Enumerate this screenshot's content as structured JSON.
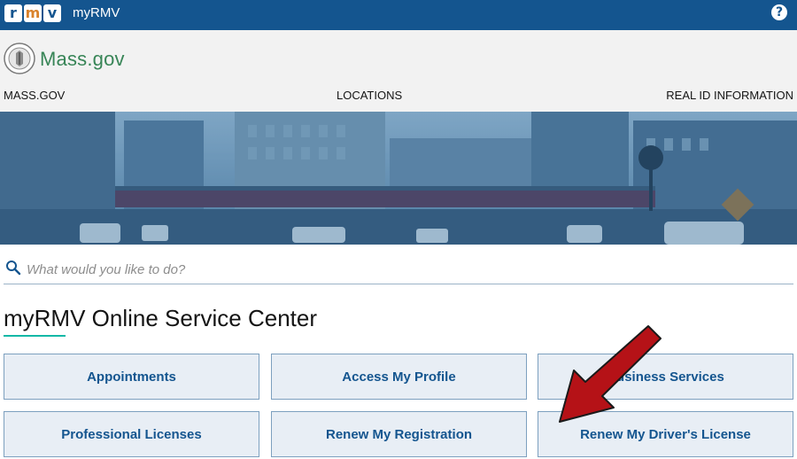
{
  "topbar": {
    "logo_letters": [
      "r",
      "m",
      "v"
    ],
    "app_title": "myRMV",
    "help_symbol": "?"
  },
  "mass_header": {
    "site_name": "Mass.gov",
    "nav": [
      "MASS.GOV",
      "LOCATIONS",
      "REAL ID INFORMATION"
    ]
  },
  "search": {
    "placeholder": "What would you like to do?"
  },
  "main": {
    "title": "myRMV Online Service Center",
    "services": [
      "Appointments",
      "Access My Profile",
      "Business Services",
      "Professional Licenses",
      "Renew My Registration",
      "Renew My Driver's License"
    ]
  },
  "colors": {
    "topbar": "#14558f",
    "brand_green": "#388557",
    "button_text": "#14558f",
    "button_bg": "#e8eef5",
    "arrow": "#b51217"
  },
  "icons": [
    "help-icon",
    "state-seal-icon",
    "search-icon",
    "annotation-arrow"
  ]
}
